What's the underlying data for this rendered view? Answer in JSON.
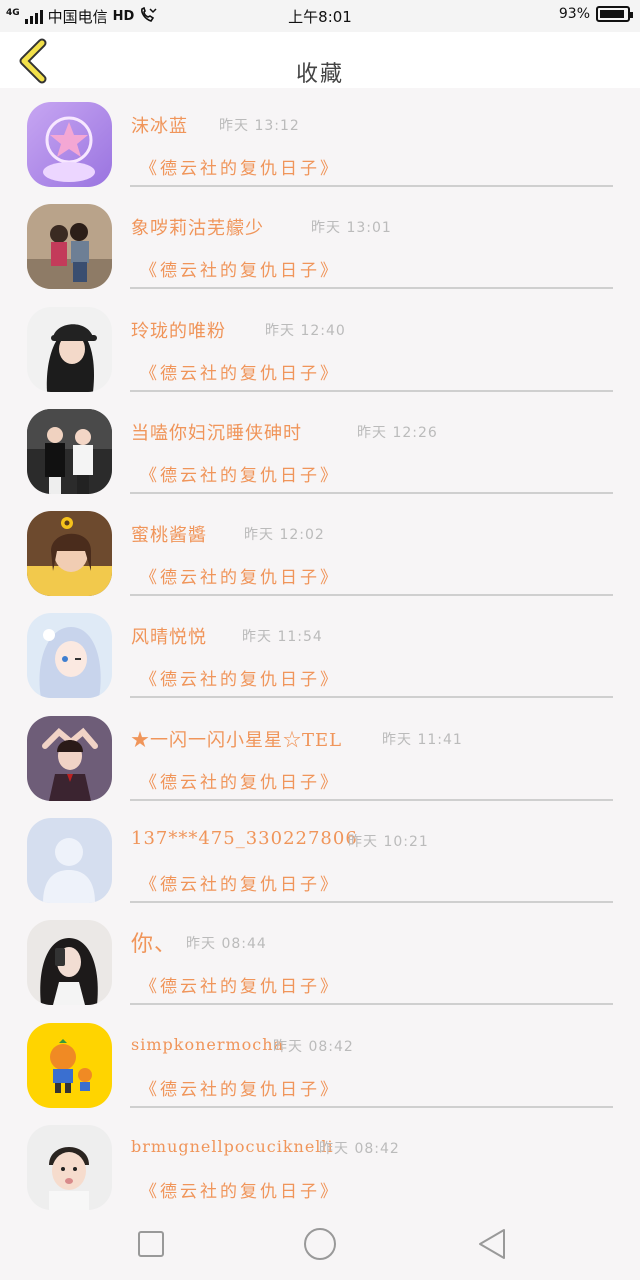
{
  "status_bar": {
    "network": "4G",
    "carrier": "中国电信",
    "hd": "HD",
    "time": "上午8:01",
    "battery_text": "93%",
    "battery_level": 0.93
  },
  "header": {
    "title": "收藏",
    "back_icon": "chevron-left-icon",
    "accent_color": "#f0955a"
  },
  "items": [
    {
      "name": "沫冰蓝",
      "time": "昨天 13:12",
      "story": "《德云社的复仇日子》",
      "avatar": "sailor-moon-avatar"
    },
    {
      "name": "象哕莉沽芜艨少",
      "time": "昨天 13:01",
      "story": "《德云社的复仇日子》",
      "avatar": "couple-photo-avatar"
    },
    {
      "name": "玲珑的唯粉",
      "time": "昨天 12:40",
      "story": "《德云社的复仇日子》",
      "avatar": "girl-cap-avatar"
    },
    {
      "name": "当嗑你妇沉睡侠砷时",
      "time": "昨天 12:26",
      "story": "《德云社的复仇日子》",
      "avatar": "couple-street-avatar"
    },
    {
      "name": "蜜桃酱醬",
      "time": "昨天 12:02",
      "story": "《德云社的复仇日子》",
      "avatar": "girl-sunflower-avatar"
    },
    {
      "name": "风晴悦悦",
      "time": "昨天 11:54",
      "story": "《德云社的复仇日子》",
      "avatar": "anime-girl-avatar"
    },
    {
      "name": "★一闪一闪小星星☆TEL",
      "time": "昨天 11:41",
      "story": "《德云社的复仇日子》",
      "avatar": "girl-portrait-avatar"
    },
    {
      "name": "137***475_330227806",
      "time": "昨天 10:21",
      "story": "《德云社的复仇日子》",
      "avatar": "default-user-avatar"
    },
    {
      "name": "你、",
      "time": "昨天 08:44",
      "story": "《德云社的复仇日子》",
      "avatar": "girl-selfie-avatar"
    },
    {
      "name": "simpkonermocha",
      "time": "昨天 08:42",
      "story": "《德云社的复仇日子》",
      "avatar": "cartoon-orange-avatar"
    },
    {
      "name": "brmugnellpocuciknelli",
      "time": "昨天 08:42",
      "story": "《德云社的复仇日子》",
      "avatar": "boy-photo-avatar"
    }
  ],
  "nav": {
    "recent_icon": "square-icon",
    "home_icon": "circle-icon",
    "back_icon": "triangle-back-icon"
  }
}
